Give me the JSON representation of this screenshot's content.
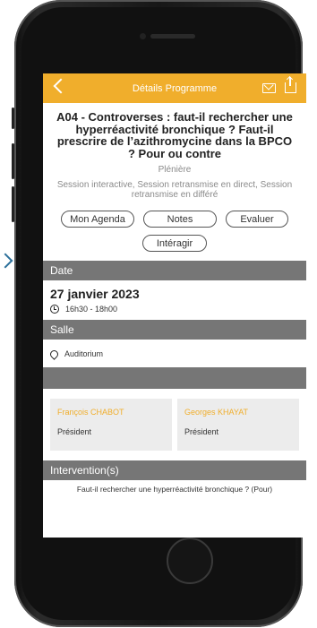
{
  "nav": {
    "title": "Détails Programme",
    "back_icon": "chevron-left-icon",
    "mail_icon": "mail-icon",
    "share_icon": "share-icon",
    "accent_color": "#f0ae2c"
  },
  "session": {
    "title": "A04 - Controverses : faut-il rechercher une hyperréactivité bronchique ? Faut-il prescrire de l’azithromycine dans la BPCO ? Pour ou contre",
    "type": "Plénière",
    "info": "Session interactive, Session retransmise en direct, Session retransmise en différé"
  },
  "actions": {
    "agenda": "Mon Agenda",
    "notes": "Notes",
    "evaluate": "Evaluer",
    "interact": "Intéragir"
  },
  "date_section": {
    "header": "Date",
    "date": "27 janvier 2023",
    "time": "16h30 - 18h00"
  },
  "room_section": {
    "header": "Salle",
    "room": "Auditorium"
  },
  "speakers": [
    {
      "name": "François CHABOT",
      "role": "Président"
    },
    {
      "name": "Georges KHAYAT",
      "role": "Président"
    }
  ],
  "interventions": {
    "header": "Intervention(s)",
    "items": [
      "Faut-il rechercher une hyperréactivité bronchique ? (Pour)"
    ]
  }
}
